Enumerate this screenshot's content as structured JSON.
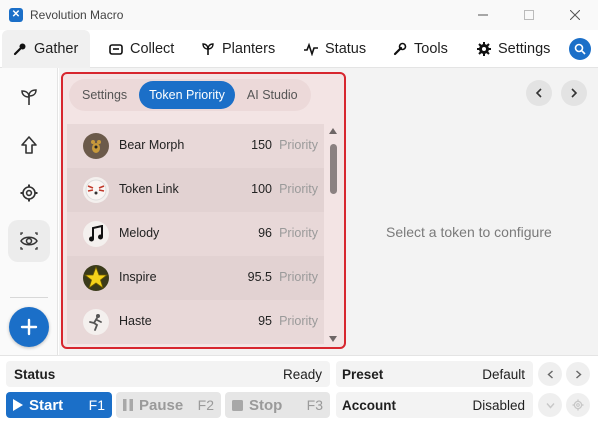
{
  "window": {
    "title": "Revolution Macro",
    "minimize_icon": "minimize-icon",
    "maximize_icon": "maximize-icon",
    "close_icon": "close-icon"
  },
  "topnav": {
    "tabs": [
      {
        "label": "Gather",
        "icon": "gather-icon",
        "active": true
      },
      {
        "label": "Collect",
        "icon": "collect-icon",
        "active": false
      },
      {
        "label": "Planters",
        "icon": "planters-icon",
        "active": false
      },
      {
        "label": "Status",
        "icon": "status-icon",
        "active": false
      },
      {
        "label": "Tools",
        "icon": "tools-icon",
        "active": false
      },
      {
        "label": "Settings",
        "icon": "gear-icon",
        "active": false
      }
    ],
    "search_icon": "search-icon"
  },
  "sidebar": {
    "items": [
      {
        "icon": "sprout-icon"
      },
      {
        "icon": "arrow-up-icon"
      },
      {
        "icon": "gear-icon"
      },
      {
        "icon": "eye-icon",
        "active": true
      }
    ],
    "add_icon": "plus-icon"
  },
  "subtabs": [
    {
      "label": "Settings",
      "active": false
    },
    {
      "label": "Token Priority",
      "active": true
    },
    {
      "label": "AI Studio",
      "active": false
    }
  ],
  "tokens": [
    {
      "name": "Bear Morph",
      "value": "150",
      "suffix": "Priority",
      "icon": "bear-morph-icon"
    },
    {
      "name": "Token Link",
      "value": "100",
      "suffix": "Priority",
      "icon": "token-link-icon"
    },
    {
      "name": "Melody",
      "value": "96",
      "suffix": "Priority",
      "icon": "melody-icon"
    },
    {
      "name": "Inspire",
      "value": "95.5",
      "suffix": "Priority",
      "icon": "inspire-icon"
    },
    {
      "name": "Haste",
      "value": "95",
      "suffix": "Priority",
      "icon": "haste-icon"
    }
  ],
  "detail": {
    "placeholder": "Select a token to configure"
  },
  "bottom": {
    "status_label": "Status",
    "status_value": "Ready",
    "start_label": "Start",
    "start_key": "F1",
    "pause_label": "Pause",
    "pause_key": "F2",
    "stop_label": "Stop",
    "stop_key": "F3",
    "preset_label": "Preset",
    "preset_value": "Default",
    "account_label": "Account",
    "account_value": "Disabled"
  },
  "colors": {
    "accent": "#1b6fc8",
    "highlight_border": "#d7262e"
  }
}
